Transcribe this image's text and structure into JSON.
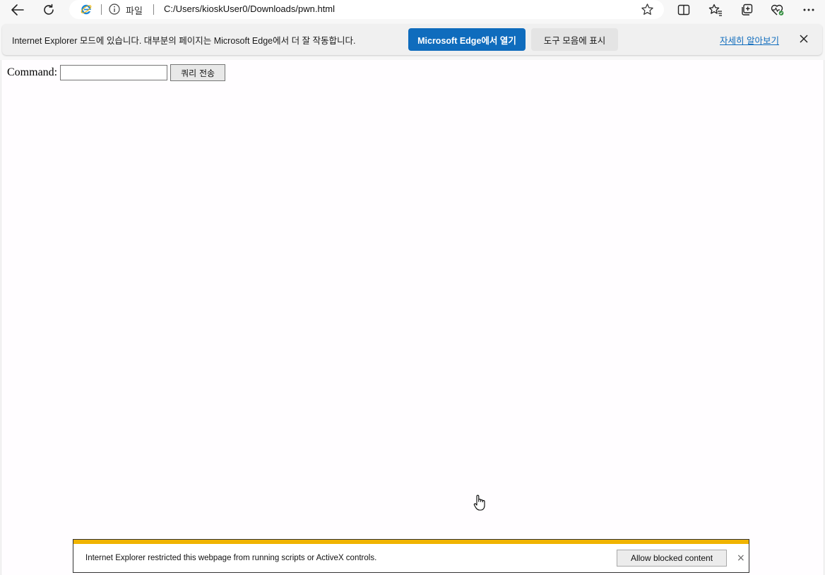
{
  "toolbar": {
    "back_icon": "arrow-left-icon",
    "refresh_icon": "refresh-icon",
    "split_screen_icon": "split-screen-icon",
    "favorites_icon": "favorites-icon",
    "collections_icon": "collections-icon",
    "health_icon": "browser-essentials-icon",
    "more_icon": "more-icon"
  },
  "address": {
    "site_label": "파일",
    "url": "C:/Users/kioskUser0/Downloads/pwn.html"
  },
  "iebar": {
    "message": "Internet Explorer 모드에 있습니다. 대부분의 페이지는 Microsoft Edge에서 더 잘 작동합니다.",
    "open_edge_label": "Microsoft Edge에서 열기",
    "show_toolbar_label": "도구 모음에 표시",
    "learn_more_label": "자세히 알아보기",
    "accent_color": "#0f6cbd"
  },
  "page": {
    "command_label": "Command:",
    "command_value": "",
    "submit_label": "쿼리 전송"
  },
  "notification": {
    "message": "Internet Explorer restricted this webpage from running scripts or ActiveX controls.",
    "allow_label": "Allow blocked content",
    "close_label": "×",
    "stripe_color": "#f0b400"
  }
}
